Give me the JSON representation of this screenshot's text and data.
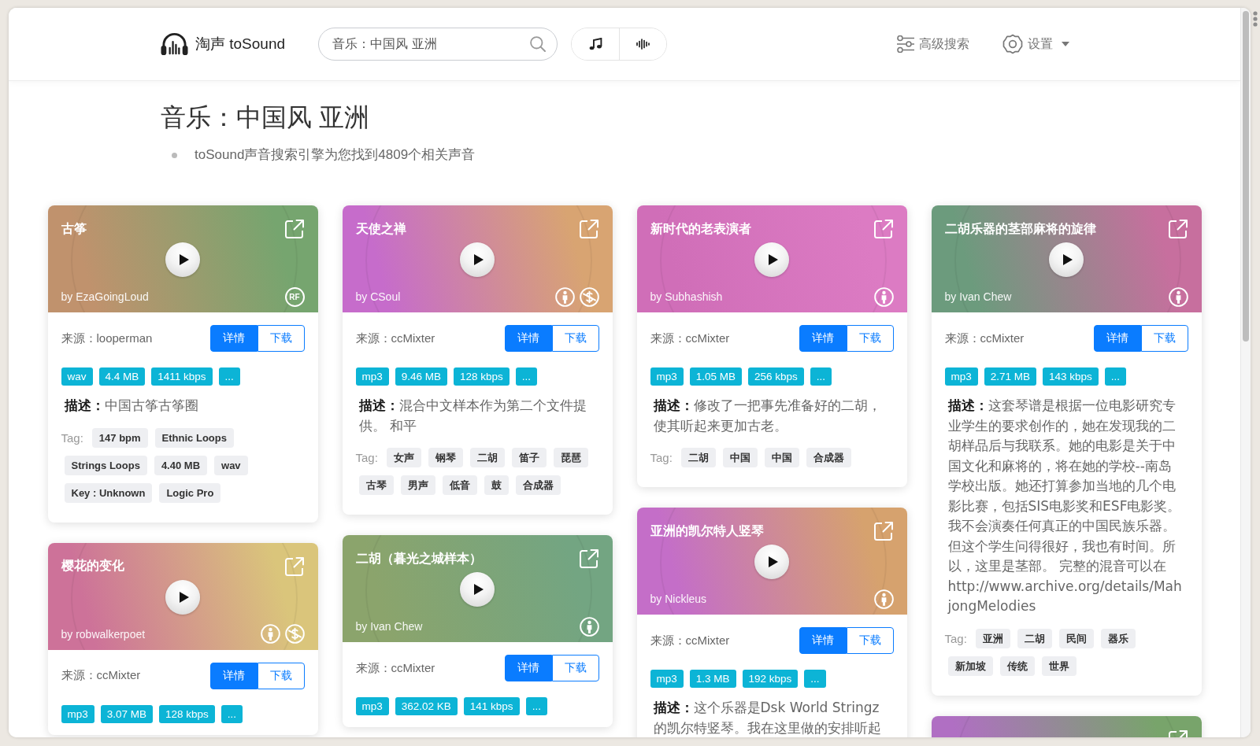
{
  "header": {
    "logo_text": "淘声 toSound",
    "search": {
      "value": "音乐：中国风 亚洲"
    },
    "advanced_search": "高级搜索",
    "settings": "设置"
  },
  "title": "音乐：中国风 亚洲",
  "summary": "toSound声音搜索引擎为您找到4809个相关声音",
  "columns": [
    {
      "cards": [
        {
          "title": "古筝",
          "author": "by EzaGoingLoud",
          "gradient": [
            {
              "color": "#c0926d"
            },
            {
              "color": "#76a56f"
            }
          ],
          "licenses": [
            {
              "kind": "rf",
              "label": "RF"
            }
          ],
          "source": "来源：looperman",
          "buttons": [
            {
              "kind": "details",
              "label": "详情"
            },
            {
              "kind": "download",
              "label": "下载"
            }
          ],
          "formats": [
            "wav",
            "4.4 MB",
            "1411 kbps",
            "..."
          ],
          "description": "**描述：**中国古筝古筝圈",
          "tag_label": "Tag:",
          "tags": [
            "147 bpm",
            "Ethnic Loops",
            "Strings Loops",
            "4.40 MB",
            "wav",
            "Key : Unknown",
            "Logic Pro"
          ]
        },
        {
          "title": "樱花的变化",
          "author": "by robwalkerpoet",
          "gradient": [
            {
              "color": "#cd7299"
            },
            {
              "color": "#dac57b"
            }
          ],
          "licenses": [
            {
              "kind": "attribution"
            },
            {
              "kind": "noncommercial"
            }
          ],
          "source": "来源：ccMixter",
          "buttons": [
            {
              "kind": "details",
              "label": "详情"
            },
            {
              "kind": "download",
              "label": "下载"
            }
          ],
          "formats": [
            "mp3",
            "3.07 MB",
            "128 kbps",
            "..."
          ]
        }
      ]
    },
    {
      "cards": [
        {
          "title": "天使之禅",
          "author": "by CSoul",
          "gradient": [
            {
              "color": "#c66ccb"
            },
            {
              "color": "#d8a472"
            }
          ],
          "licenses": [
            {
              "kind": "attribution"
            },
            {
              "kind": "noncommercial"
            }
          ],
          "source": "来源：ccMixter",
          "buttons": [
            {
              "kind": "details",
              "label": "详情"
            },
            {
              "kind": "download",
              "label": "下载"
            }
          ],
          "formats": [
            "mp3",
            "9.46 MB",
            "128 kbps",
            "..."
          ],
          "description": "**描述：**混合中文样本作为第二个文件提供。 和平",
          "tag_label": "Tag:",
          "tags": [
            "女声",
            "钢琴",
            "二胡",
            "笛子",
            "琵琶",
            "古琴",
            "男声",
            "低音",
            "鼓",
            "合成器"
          ]
        },
        {
          "title": "二胡（暮光之城样本）",
          "author": "by Ivan Chew",
          "gradient": [
            {
              "color": "#8ba46c"
            },
            {
              "color": "#73a582"
            }
          ],
          "licenses": [
            {
              "kind": "attribution"
            }
          ],
          "source": "来源：ccMixter",
          "buttons": [
            {
              "kind": "details",
              "label": "详情"
            },
            {
              "kind": "download",
              "label": "下载"
            }
          ],
          "formats": [
            "mp3",
            "362.02 KB",
            "141 kbps",
            "..."
          ]
        }
      ]
    },
    {
      "cards": [
        {
          "title": "新时代的老表演者",
          "author": "by Subhashish",
          "gradient": [
            {
              "color": "#d06eb8"
            },
            {
              "color": "#dc7bc3"
            }
          ],
          "licenses": [
            {
              "kind": "attribution"
            }
          ],
          "source": "来源：ccMixter",
          "buttons": [
            {
              "kind": "details",
              "label": "详情"
            },
            {
              "kind": "download",
              "label": "下载"
            }
          ],
          "formats": [
            "mp3",
            "1.05 MB",
            "256 kbps",
            "..."
          ],
          "description": "**描述：**修改了一把事先准备好的二胡，使其听起来更加古老。",
          "tag_label": "Tag:",
          "tags": [
            "二胡",
            "中国",
            "中国",
            "合成器"
          ]
        },
        {
          "title": "亚洲的凯尔特人竖琴",
          "author": "by Nickleus",
          "gradient": [
            {
              "color": "#c46ec8"
            },
            {
              "color": "#d6a26e"
            }
          ],
          "licenses": [
            {
              "kind": "attribution"
            }
          ],
          "source": "来源：ccMixter",
          "buttons": [
            {
              "kind": "details",
              "label": "详情"
            },
            {
              "kind": "download",
              "label": "下载"
            }
          ],
          "formats": [
            "mp3",
            "1.3 MB",
            "192 kbps",
            "..."
          ],
          "description": "**描述：**这个乐器是Dsk World Stringz的凯尔特竖琴。我在这里做的安排听起"
        }
      ]
    },
    {
      "cards": [
        {
          "title": "二胡乐器的茎部麻将的旋律",
          "author": "by Ivan Chew",
          "gradient": [
            {
              "color": "#6c9b7d"
            },
            {
              "color": "#c76f9e"
            }
          ],
          "licenses": [
            {
              "kind": "attribution"
            }
          ],
          "source": "来源：ccMixter",
          "buttons": [
            {
              "kind": "details",
              "label": "详情"
            },
            {
              "kind": "download",
              "label": "下载"
            }
          ],
          "formats": [
            "mp3",
            "2.71 MB",
            "143 kbps",
            "..."
          ],
          "description": "**描述：**这套琴谱是根据一位电影研究专业学生的要求创作的，她在发现我的二胡样品后与我联系。她的电影是关于中国文化和麻将的，将在她的学校--南岛学校出版。她还打算参加当地的几个电影比赛，包括SIS电影奖和ESF电影奖。我不会演奏任何真正的中国民族乐器。但这个学生问得很好，我也有时间。所以，这里是茎部。 完整的混音可以在http://www.archive.org/details/MahjongMelodies",
          "tag_label": "Tag:",
          "tags": [
            "亚洲",
            "二胡",
            "民间",
            "器乐",
            "新加坡",
            "传统",
            "世界"
          ]
        },
        {
          "gradient": [
            {
              "color": "#b06fc3"
            },
            {
              "color": "#78a46b"
            }
          ]
        }
      ]
    }
  ]
}
